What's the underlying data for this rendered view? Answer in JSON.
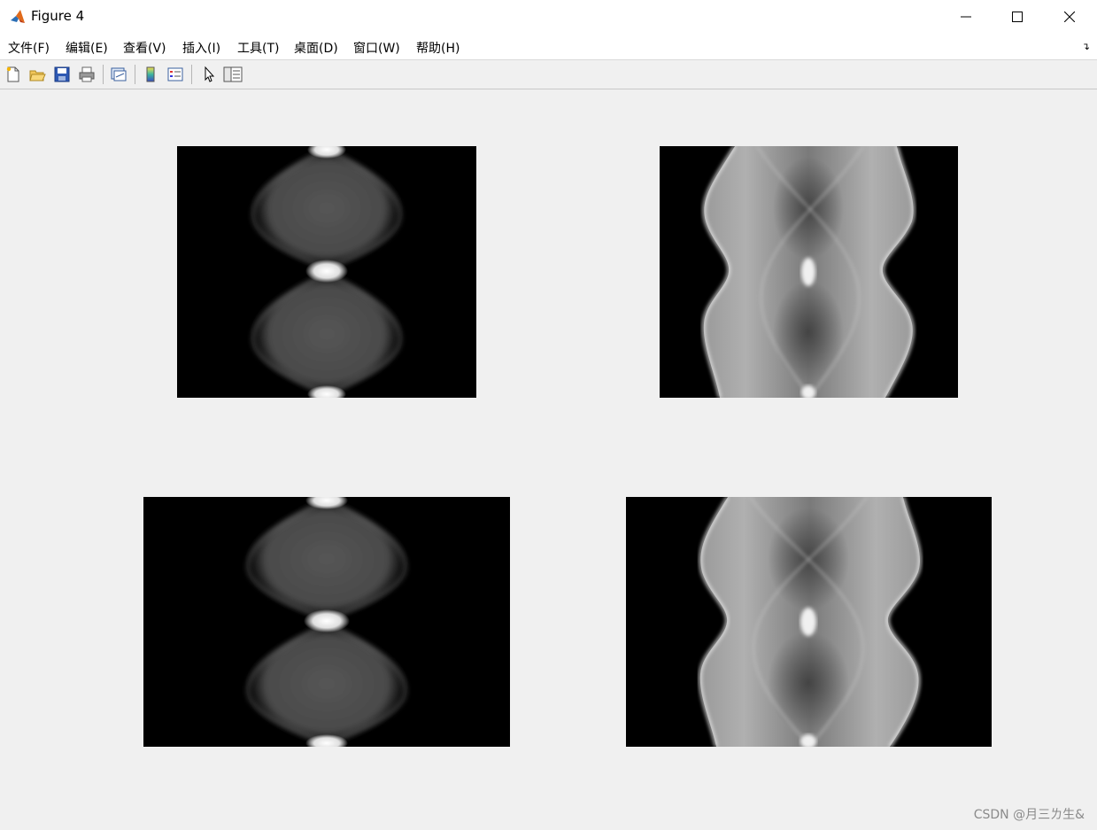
{
  "window": {
    "title": "Figure 4",
    "controls": [
      "minimize",
      "maximize",
      "close"
    ]
  },
  "menubar": {
    "items": [
      {
        "label": "文件(F)"
      },
      {
        "label": "编辑(E)"
      },
      {
        "label": "查看(V)"
      },
      {
        "label": "插入(I)"
      },
      {
        "label": "工具(T)"
      },
      {
        "label": "桌面(D)"
      },
      {
        "label": "窗口(W)"
      },
      {
        "label": "帮助(H)"
      }
    ]
  },
  "toolbar": {
    "buttons": [
      "new-figure-icon",
      "open-file-icon",
      "save-icon",
      "print-icon",
      "link-plot-icon",
      "insert-colorbar-icon",
      "insert-legend-icon",
      "edit-plot-cursor-icon",
      "property-inspector-icon"
    ]
  },
  "figure": {
    "plots": [
      {
        "name": "sinogram-narrow-top-left",
        "style": "narrow"
      },
      {
        "name": "sinogram-wide-top-right",
        "style": "wide"
      },
      {
        "name": "sinogram-narrow-bottom-left",
        "style": "narrow"
      },
      {
        "name": "sinogram-wide-bottom-right",
        "style": "wide"
      }
    ]
  },
  "watermark": {
    "text": "CSDN @月三ㄌ生&"
  }
}
